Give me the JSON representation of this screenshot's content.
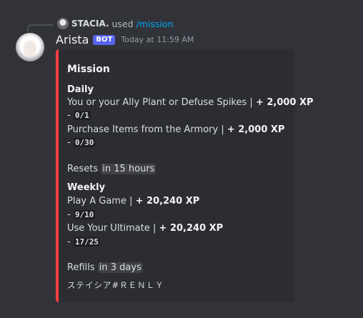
{
  "reply": {
    "username": "STACIA.",
    "action": "used",
    "command": "/mission"
  },
  "message": {
    "author": "Arista",
    "bot_tag": "BOT",
    "timestamp": "Today at 11:59 AM"
  },
  "embed": {
    "accent_color": "#f23f43",
    "title": "Mission",
    "daily": {
      "heading": "Daily",
      "tasks": [
        {
          "name": "You or your Ally Plant or Defuse Spikes |",
          "xp": "+ 2,000 XP",
          "dash": "-",
          "progress": "0/1"
        },
        {
          "name": "Purchase Items from the Armory |",
          "xp": "+ 2,000 XP",
          "dash": "-",
          "progress": "0/30"
        }
      ],
      "reset_label": "Resets",
      "reset_time": "in 15 hours"
    },
    "weekly": {
      "heading": "Weekly",
      "tasks": [
        {
          "name": "Play A Game |",
          "xp": "+ 20,240 XP",
          "dash": "-",
          "progress": "9/10"
        },
        {
          "name": "Use Your Ultimate |",
          "xp": "+ 20,240 XP",
          "dash": "-",
          "progress": "17/25"
        }
      ],
      "reset_label": "Refills",
      "reset_time": "in 3 days"
    },
    "footer": "ステイシア#ＲＥＮＬＹ"
  }
}
